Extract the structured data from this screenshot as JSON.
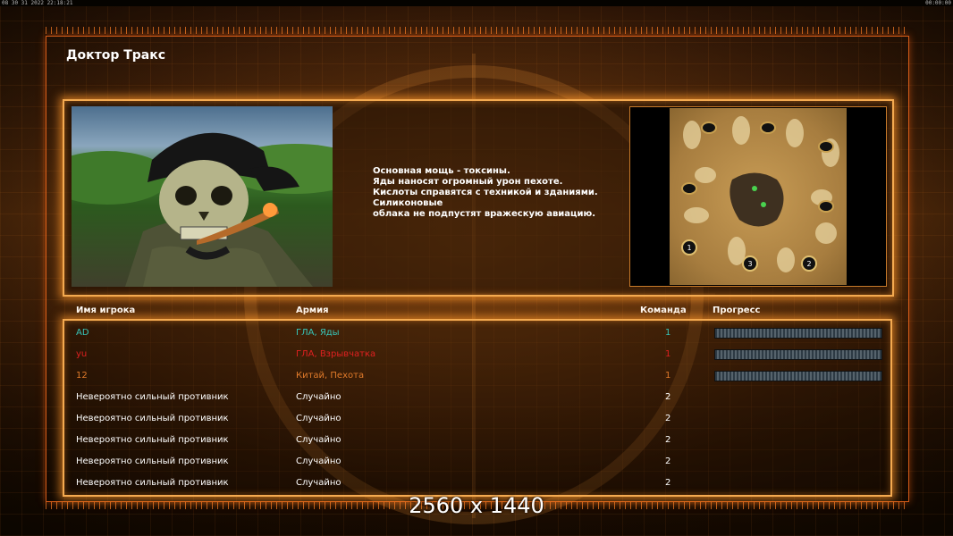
{
  "clock": {
    "left": "08 30 31 2022 22:18:21",
    "right": "00:00:00"
  },
  "title": "Доктор Тракс",
  "description": "Основная мощь - токсины.\nЯды наносят огромный урон пехоте.\nКислоты справятся с техникой и зданиями.\nСиликоновые\nоблака не подпустят вражескую авиацию.",
  "headers": {
    "name": "Имя игрока",
    "army": "Армия",
    "team": "Команда",
    "progress": "Прогресс"
  },
  "players": [
    {
      "name": "AD",
      "army": "ГЛА, Яды",
      "team": "1",
      "color": "#37c4b8",
      "progress": true
    },
    {
      "name": "yu",
      "army": "ГЛА, Взрывчатка",
      "team": "1",
      "color": "#e02020",
      "progress": true
    },
    {
      "name": "12",
      "army": "Китай, Пехота",
      "team": "1",
      "color": "#e07a2a",
      "progress": true
    },
    {
      "name": "Невероятно сильный противник",
      "army": "Случайно",
      "team": "2",
      "color": "#ffffff",
      "progress": false
    },
    {
      "name": "Невероятно сильный противник",
      "army": "Случайно",
      "team": "2",
      "color": "#ffffff",
      "progress": false
    },
    {
      "name": "Невероятно сильный противник",
      "army": "Случайно",
      "team": "2",
      "color": "#ffffff",
      "progress": false
    },
    {
      "name": "Невероятно сильный противник",
      "army": "Случайно",
      "team": "2",
      "color": "#ffffff",
      "progress": false
    },
    {
      "name": "Невероятно сильный противник",
      "army": "Случайно",
      "team": "2",
      "color": "#ffffff",
      "progress": false
    }
  ],
  "map": {
    "start_markers": [
      "1",
      "2",
      "3"
    ]
  },
  "resolution": "2560 x 1440"
}
